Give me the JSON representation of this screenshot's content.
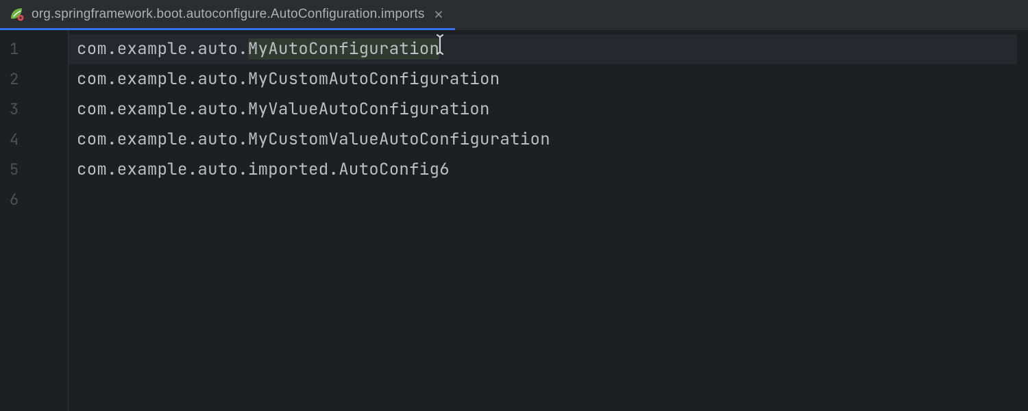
{
  "tab": {
    "title": "org.springframework.boot.autoconfigure.AutoConfiguration.imports",
    "icon": "spring-leaf-icon",
    "close": "×"
  },
  "editor": {
    "line_numbers": [
      "1",
      "2",
      "3",
      "4",
      "5",
      "6"
    ],
    "highlighted_line_index": 0,
    "cursor_line_index": 0,
    "lines": [
      {
        "pre": "com.example.auto.",
        "hl": "MyAutoConfiguration",
        "post": ""
      },
      {
        "pre": "com.example.auto.MyCustomAutoConfiguration",
        "hl": "",
        "post": ""
      },
      {
        "pre": "com.example.auto.MyValueAutoConfiguration",
        "hl": "",
        "post": ""
      },
      {
        "pre": "com.example.auto.MyCustomValueAutoConfiguration",
        "hl": "",
        "post": ""
      },
      {
        "pre": "com.example.auto.imported.AutoConfig6",
        "hl": "",
        "post": ""
      },
      {
        "pre": "",
        "hl": "",
        "post": ""
      }
    ]
  }
}
